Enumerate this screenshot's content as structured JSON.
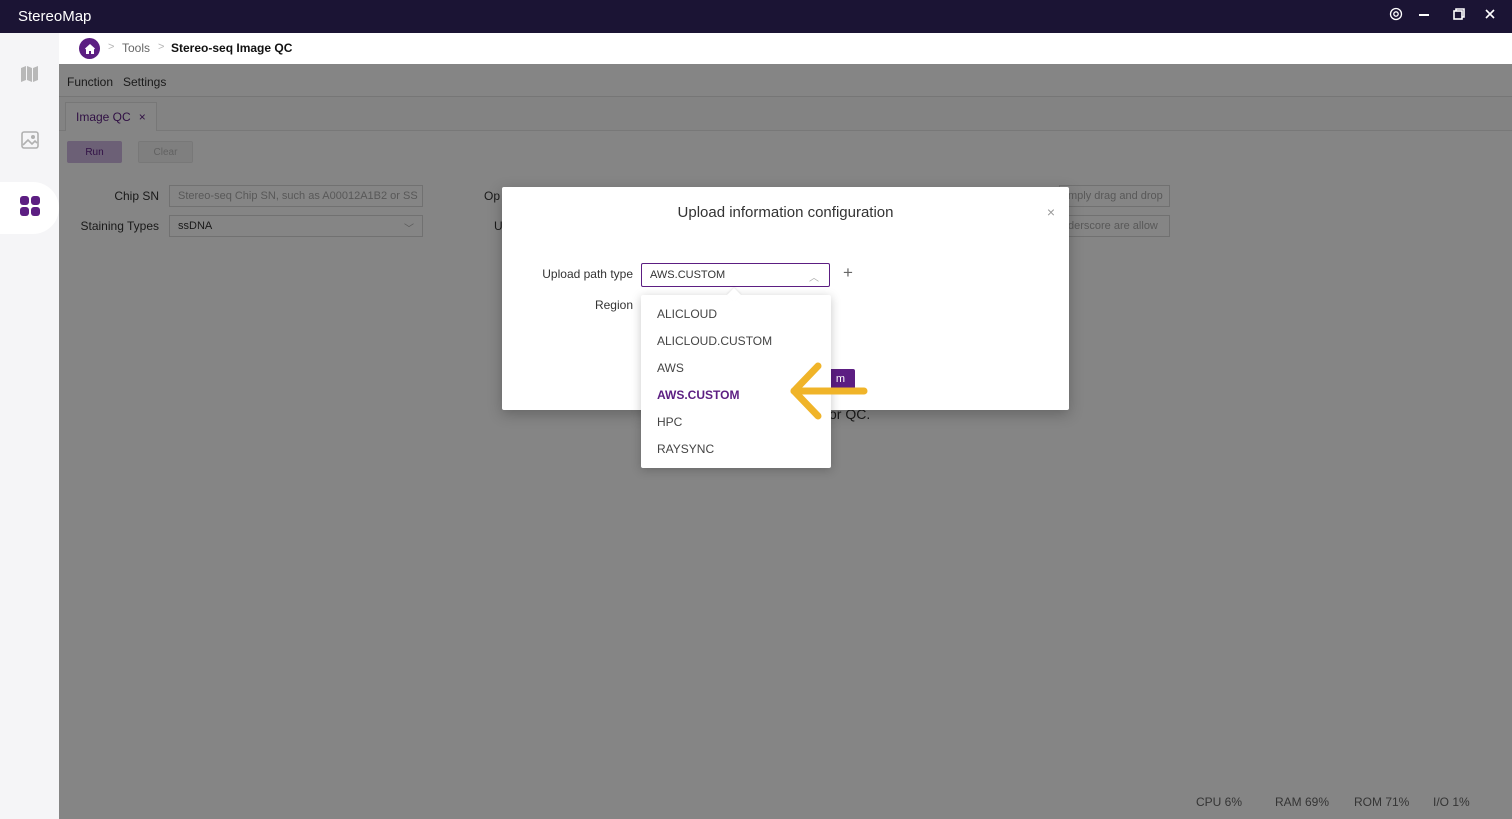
{
  "app": {
    "title": "StereoMap",
    "window_controls": [
      "settings-icon",
      "minimize-icon",
      "restore-icon",
      "close-icon"
    ]
  },
  "breadcrumb": {
    "items": [
      "Tools",
      "Stereo-seq Image QC"
    ]
  },
  "menu": {
    "items": [
      "Function",
      "Settings"
    ]
  },
  "tabs": [
    {
      "label": "Image QC",
      "close": "×"
    }
  ],
  "toolbar": {
    "run_label": "Run",
    "clear_label": "Clear"
  },
  "form": {
    "chip_sn_label": "Chip SN",
    "chip_sn_placeholder": "Stereo-seq Chip SN, such as A00012A1B2 or SS",
    "staining_label": "Staining Types",
    "staining_value": "ssDNA",
    "op_label": "Op",
    "u_label": "U",
    "right_hint_1": "mply drag and drop",
    "right_hint_2": "derscore are allow"
  },
  "background_hint": "or QC.",
  "status": {
    "cpu": "CPU 6%",
    "ram": "RAM 69%",
    "rom": "ROM 71%",
    "io": "I/O 1%"
  },
  "modal": {
    "title": "Upload information configuration",
    "close": "×",
    "upload_path_type_label": "Upload path type",
    "upload_path_type_value": "AWS.CUSTOM",
    "region_label": "Region",
    "confirm_label": "m",
    "add_symbol": "+"
  },
  "dropdown": {
    "options": [
      "ALICLOUD",
      "ALICLOUD.CUSTOM",
      "AWS",
      "AWS.CUSTOM",
      "HPC",
      "RAYSYNC"
    ],
    "selected": "AWS.CUSTOM"
  },
  "colors": {
    "brand": "#5c1e82",
    "titlebar": "#1b1434",
    "annotation": "#f0b429"
  }
}
